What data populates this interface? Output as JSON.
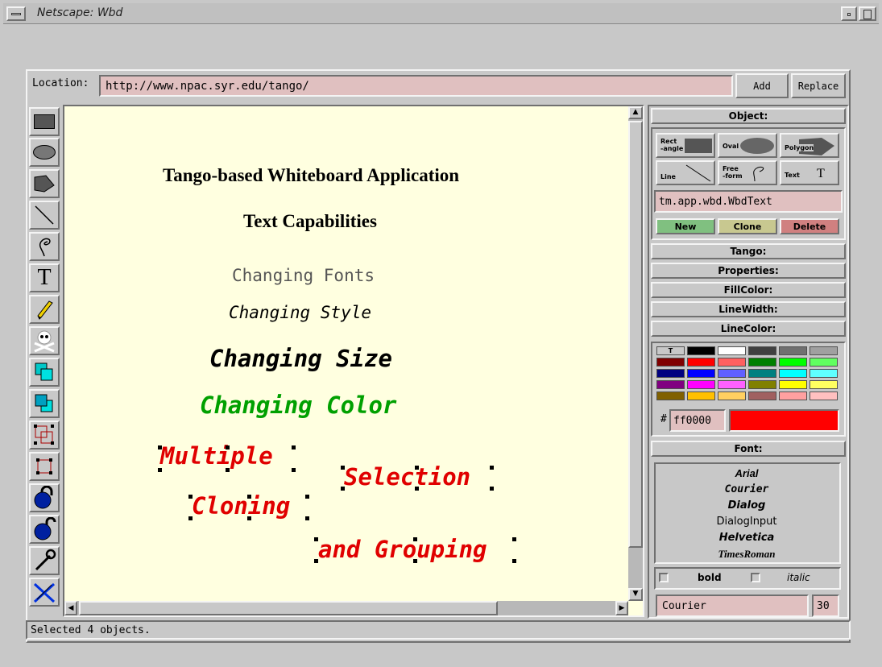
{
  "window": {
    "title": "Netscape: Wbd"
  },
  "location": {
    "label": "Location:",
    "url": "http://www.npac.syr.edu/tango/",
    "add_label": "Add",
    "replace_label": "Replace"
  },
  "tools": [
    "rectangle-icon",
    "oval-icon",
    "polygon-icon",
    "line-icon",
    "freeform-icon",
    "text-icon",
    "pencil-icon",
    "skull-crossbones-icon",
    "bring-to-front-icon",
    "send-to-back-icon",
    "group-icon",
    "ungroup-icon",
    "lock-icon",
    "unlock-icon",
    "wrench-icon",
    "cut-tools-icon"
  ],
  "canvas": {
    "title": "Tango-based Whiteboard Application",
    "subtitle": "Text Capabilities",
    "fonts": "Changing Fonts",
    "style": "Changing Style",
    "size": "Changing Size",
    "color": "Changing Color",
    "multiple": "Multiple",
    "selection": "Selection",
    "cloning": "Cloning",
    "grouping": "and Grouping",
    "colors": {
      "green": "#00a000",
      "red": "#e00000",
      "background": "#ffffe0"
    }
  },
  "panel": {
    "object_header": "Object:",
    "shapes": {
      "rect": "Rect\n-angle",
      "oval": "Oval",
      "polygon": "Polygon",
      "line": "Line",
      "freeform": "Free\n-form",
      "text": "Text",
      "text_glyph": "T"
    },
    "class_name": "tm.app.wbd.WbdText",
    "new_label": "New",
    "clone_label": "Clone",
    "delete_label": "Delete",
    "tango_label": "Tango:",
    "properties_label": "Properties:",
    "fillcolor_label": "FillColor:",
    "linewidth_label": "LineWidth:",
    "linecolor_label": "LineColor:",
    "transparent_label": "T",
    "hash_label": "#",
    "hex_value": "ff0000",
    "selected_color": "#ff0000",
    "font_header": "Font:",
    "font_list": [
      "Arial",
      "Courier",
      "Dialog",
      "DialogInput",
      "Helvetica",
      "TimesRoman"
    ],
    "bold_label": "bold",
    "italic_label": "italic",
    "font_name": "Courier",
    "font_size": "30"
  },
  "status": {
    "text": "Selected 4 objects."
  }
}
